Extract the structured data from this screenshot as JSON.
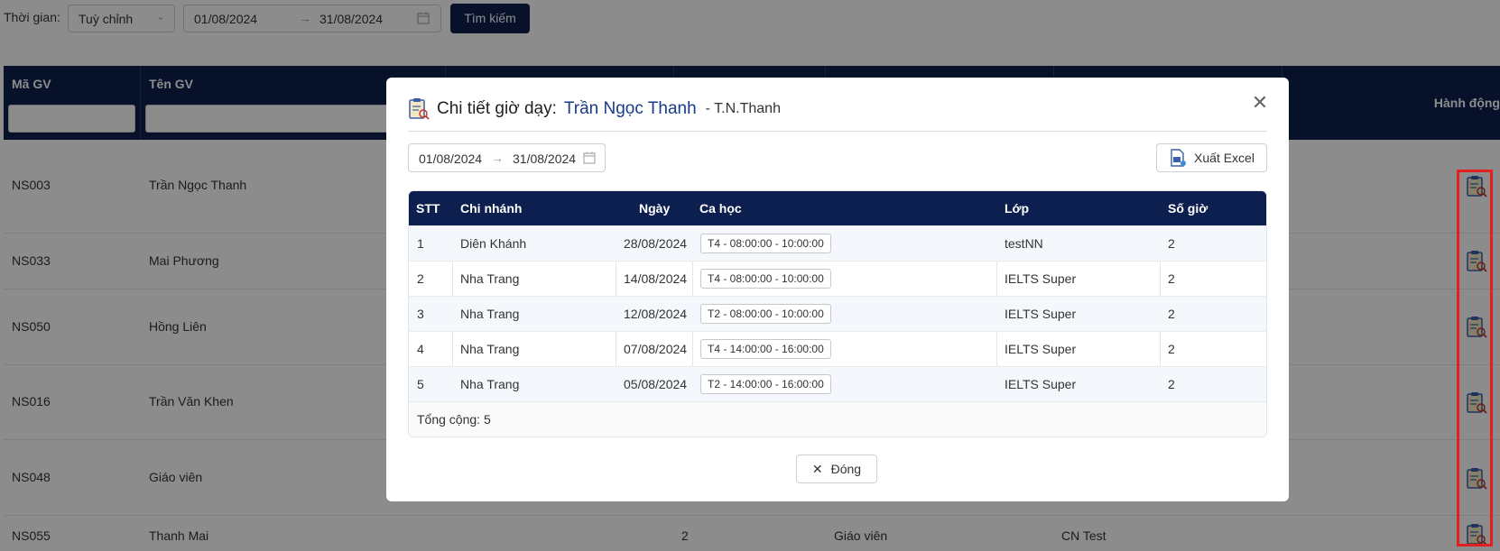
{
  "filter": {
    "time_label": "Thời gian:",
    "mode_value": "Tuỳ chỉnh",
    "date_from": "01/08/2024",
    "date_to": "31/08/2024",
    "search_label": "Tìm kiếm"
  },
  "main_table": {
    "col_code": "Mã GV",
    "col_name": "Tên GV",
    "col_action": "Hành động",
    "rows": [
      {
        "code": "NS003",
        "name": "Trần Ngọc Thanh",
        "c4": "",
        "c5": "",
        "c6": ""
      },
      {
        "code": "NS033",
        "name": "Mai Phương",
        "c4": "",
        "c5": "",
        "c6": ""
      },
      {
        "code": "NS050",
        "name": "Hồng Liên",
        "c4": "",
        "c5": "",
        "c6": ""
      },
      {
        "code": "NS016",
        "name": "Trần Văn Khen",
        "c4": "",
        "c5": "",
        "c6": ""
      },
      {
        "code": "NS048",
        "name": "Giáo viên",
        "c4": "",
        "c5": "",
        "c6": ""
      },
      {
        "code": "NS055",
        "name": "Thanh Mai",
        "c4": "2",
        "c5": "Giáo viên",
        "c6": "CN Test"
      }
    ]
  },
  "modal": {
    "title": "Chi tiết giờ dạy:",
    "teacher_name": "Trần Ngọc Thanh",
    "teacher_short": "- T.N.Thanh",
    "date_from": "01/08/2024",
    "date_to": "31/08/2024",
    "export_label": "Xuất Excel",
    "close_label": "Đóng",
    "columns": {
      "stt": "STT",
      "branch": "Chi nhánh",
      "date": "Ngày",
      "shift": "Ca học",
      "class": "Lớp",
      "hours": "Số giờ"
    },
    "rows": [
      {
        "stt": "1",
        "branch": "Diên Khánh",
        "date": "28/08/2024",
        "shift": "T4 - 08:00:00 - 10:00:00",
        "class": "testNN",
        "hours": "2"
      },
      {
        "stt": "2",
        "branch": "Nha Trang",
        "date": "14/08/2024",
        "shift": "T4 - 08:00:00 - 10:00:00",
        "class": "IELTS Super",
        "hours": "2"
      },
      {
        "stt": "3",
        "branch": "Nha Trang",
        "date": "12/08/2024",
        "shift": "T2 - 08:00:00 - 10:00:00",
        "class": "IELTS Super",
        "hours": "2"
      },
      {
        "stt": "4",
        "branch": "Nha Trang",
        "date": "07/08/2024",
        "shift": "T4 - 14:00:00 - 16:00:00",
        "class": "IELTS Super",
        "hours": "2"
      },
      {
        "stt": "5",
        "branch": "Nha Trang",
        "date": "05/08/2024",
        "shift": "T2 - 14:00:00 - 16:00:00",
        "class": "IELTS Super",
        "hours": "2"
      }
    ],
    "total": "Tổng cộng: 5"
  },
  "colors": {
    "navy": "#0d1f4e",
    "highlight": "#e32020",
    "link_blue": "#1a3a8a"
  }
}
